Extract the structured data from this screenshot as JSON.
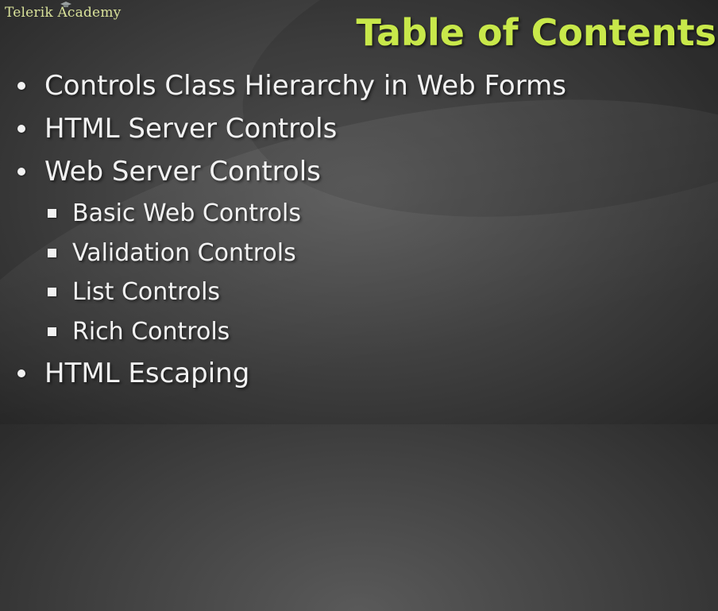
{
  "header": {
    "logo_text": "Telerik Academy",
    "title": "Table of Contents"
  },
  "items": [
    {
      "level": 1,
      "label": "Controls Class Hierarchy in Web Forms"
    },
    {
      "level": 1,
      "label": "HTML Server Controls"
    },
    {
      "level": 1,
      "label": "Web Server Controls"
    },
    {
      "level": 2,
      "label": "Basic Web Controls"
    },
    {
      "level": 2,
      "label": "Validation Controls"
    },
    {
      "level": 2,
      "label": "List Controls"
    },
    {
      "level": 2,
      "label": "Rich Controls"
    },
    {
      "level": 1,
      "label": "HTML Escaping"
    }
  ],
  "colors": {
    "title": "#c8e84a",
    "logo": "#d9e29a",
    "text": "#f2f2f2",
    "background": "#3e3e3e"
  }
}
